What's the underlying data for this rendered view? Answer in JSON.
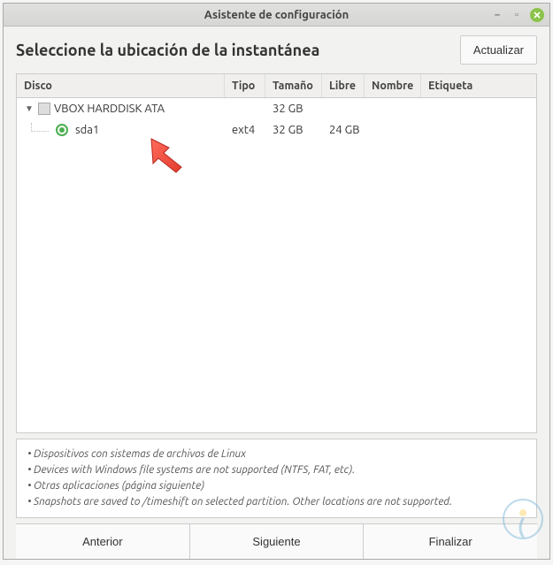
{
  "titlebar": {
    "title": "Asistente de configuración"
  },
  "header": {
    "heading": "Seleccione la ubicación de la instantánea",
    "refresh_label": "Actualizar"
  },
  "table": {
    "columns": {
      "disco": "Disco",
      "tipo": "Tipo",
      "tamano": "Tamaño",
      "libre": "Libre",
      "nombre": "Nombre",
      "etiqueta": "Etiqueta"
    },
    "rows": [
      {
        "kind": "disk",
        "label": "VBOX HARDDISK ATA",
        "tipo": "",
        "tamano": "32 GB",
        "libre": "",
        "nombre": "",
        "etiqueta": ""
      },
      {
        "kind": "part",
        "label": "sda1",
        "tipo": "ext4",
        "tamano": "32 GB",
        "libre": "24 GB",
        "nombre": "",
        "etiqueta": "",
        "selected": true
      }
    ]
  },
  "notes": [
    "Dispositivos con sistemas de archivos de Linux",
    "Devices with Windows file systems are not supported (NTFS, FAT, etc).",
    "Otras aplicaciones (página siguiente)",
    "Snapshots are saved to /timeshift on selected partition. Other locations are not supported."
  ],
  "footer": {
    "prev": "Anterior",
    "next": "Siguiente",
    "finish": "Finalizar"
  }
}
